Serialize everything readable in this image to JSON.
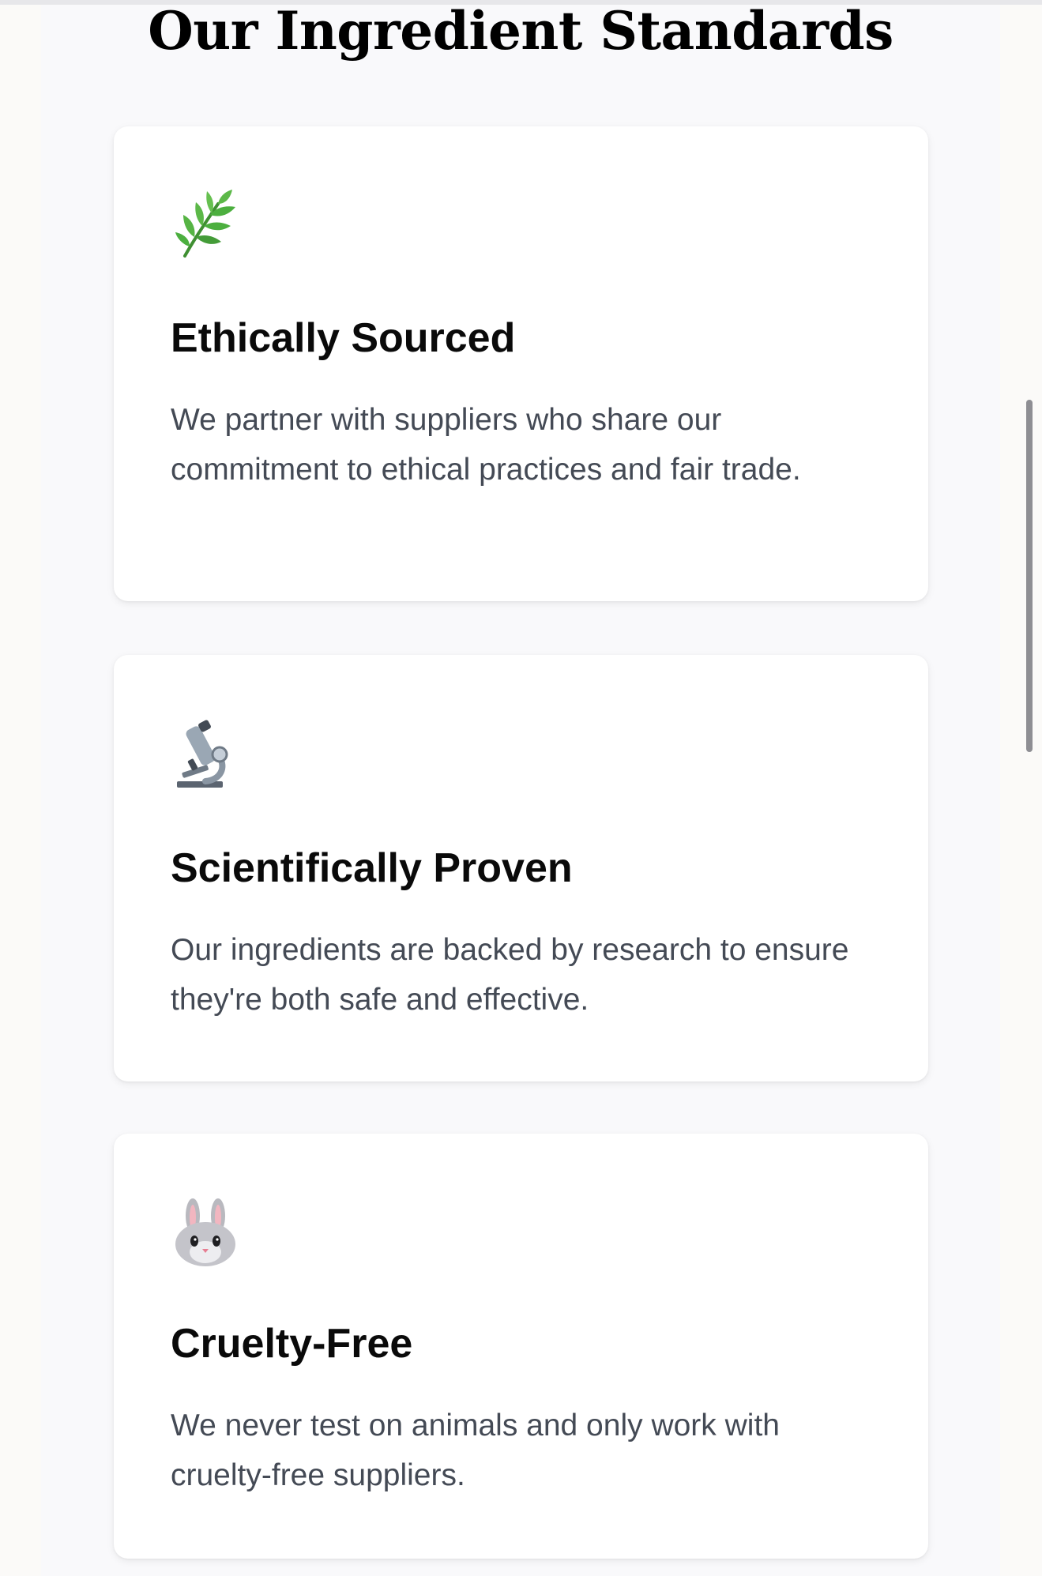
{
  "section": {
    "title": "Our Ingredient Standards"
  },
  "cards": [
    {
      "icon": "herb-icon",
      "title": "Ethically Sourced",
      "description": "We partner with suppliers who share our commitment to ethical practices and fair trade."
    },
    {
      "icon": "microscope-icon",
      "title": "Scientifically Proven",
      "description": "Our ingredients are backed by research to ensure they're both safe and effective."
    },
    {
      "icon": "rabbit-face-icon",
      "title": "Cruelty-Free",
      "description": "We never test on animals and only work with cruelty-free suppliers."
    }
  ],
  "colors": {
    "page_background": "#f9f9fb",
    "card_background": "#ffffff",
    "title_color": "#0a0a0a",
    "body_text_color": "#444a55",
    "herb_green": "#4caf3f"
  }
}
